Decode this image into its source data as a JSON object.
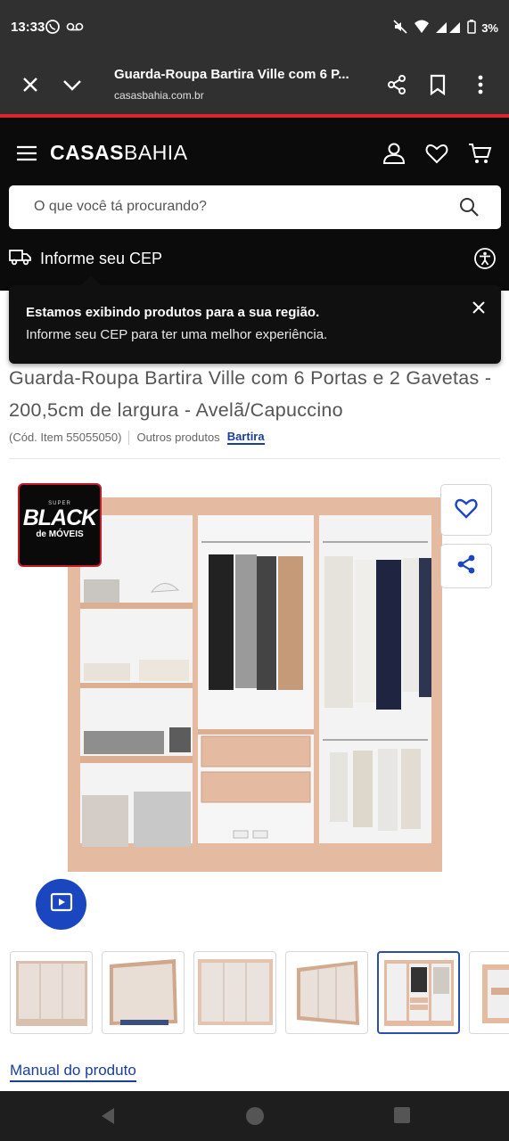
{
  "status_bar": {
    "time": "13:33",
    "battery": "3%"
  },
  "browser": {
    "page_title": "Guarda-Roupa Bartira Ville com 6 P...",
    "url": "casasbahia.com.br"
  },
  "header": {
    "logo_bold": "CASAS",
    "logo_light": "BAHIA"
  },
  "search": {
    "placeholder": "O que você tá procurando?"
  },
  "cep": {
    "label": "Informe seu CEP"
  },
  "tooltip": {
    "title": "Estamos exibindo produtos para a sua região.",
    "message": "Informe seu CEP para ter uma melhor experiência."
  },
  "product": {
    "title": "Guarda-Roupa Bartira Ville com 6 Portas e 2 Gavetas - 200,5cm de largura - Avelã/Capuccino",
    "item_code": "(Cód. Item 55055050)",
    "other_products_label": "Outros produtos",
    "brand": "Bartira"
  },
  "badge": {
    "super": "SUPER",
    "black": "BLACK",
    "sub": "de MÓVEIS"
  },
  "thumbnails": [
    {
      "kind": "closed-front"
    },
    {
      "kind": "closed-angle"
    },
    {
      "kind": "closed-front-detail"
    },
    {
      "kind": "closed-side"
    },
    {
      "kind": "open-interior"
    },
    {
      "kind": "open-partial"
    }
  ],
  "manual_link": "Manual do produto",
  "colors": {
    "accent_red": "#d8252e",
    "brand_blue": "#1a3e9a",
    "header_bg": "#0b0b0b",
    "wood": "#e2b79c"
  }
}
